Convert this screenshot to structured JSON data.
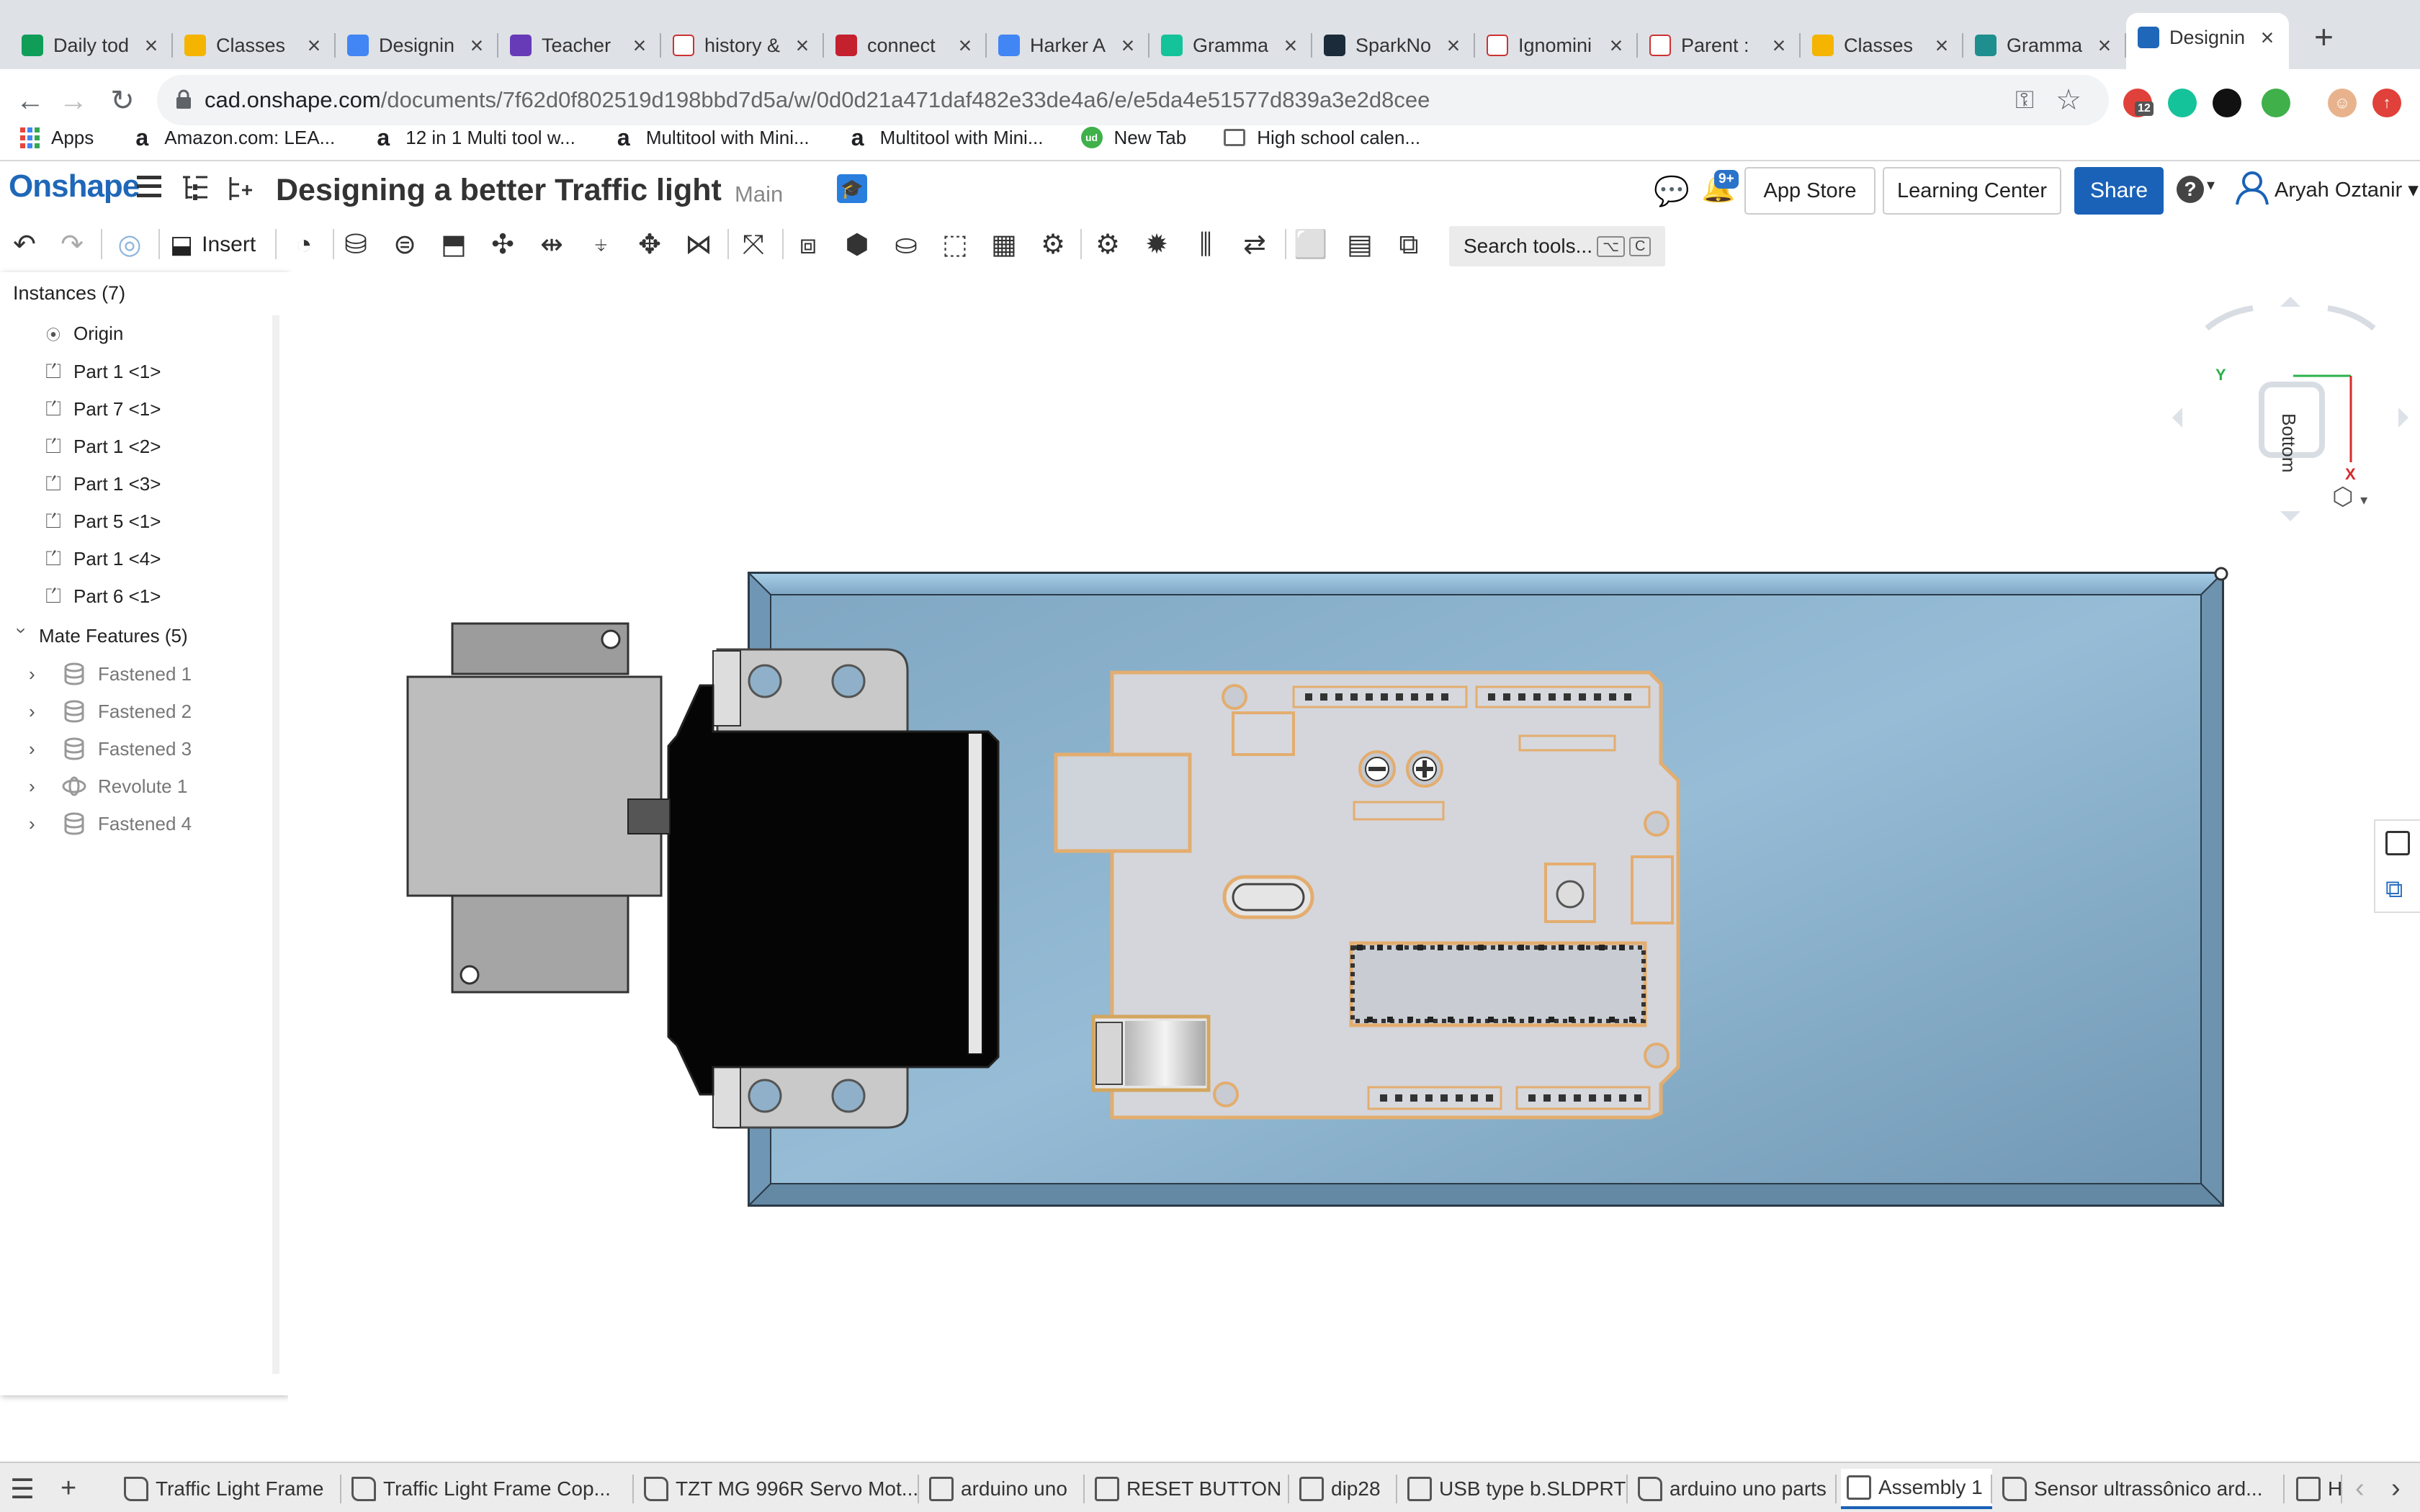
{
  "browser": {
    "tabs": [
      {
        "title": "Daily tod",
        "favicon": "sheets-icon",
        "color": "#0f9d58"
      },
      {
        "title": "Classes",
        "favicon": "classroom-icon",
        "color": "#f4b400"
      },
      {
        "title": "Designin",
        "favicon": "docs-icon",
        "color": "#4285f4"
      },
      {
        "title": "Teacher",
        "favicon": "forms-icon",
        "color": "#673ab7"
      },
      {
        "title": "history &",
        "favicon": "google-icon",
        "color": "#ffffff"
      },
      {
        "title": "connect",
        "favicon": "mcgraw-icon",
        "color": "#c4202e"
      },
      {
        "title": "Harker A",
        "favicon": "docs-icon",
        "color": "#4285f4"
      },
      {
        "title": "Gramma",
        "favicon": "grammarly-icon",
        "color": "#15c39a"
      },
      {
        "title": "SparkNo",
        "favicon": "sparknotes-icon",
        "color": "#1c2b39"
      },
      {
        "title": "Ignomini",
        "favicon": "mw-icon",
        "color": "#ffffff"
      },
      {
        "title": "Parent :",
        "favicon": "parent-icon",
        "color": "#ffffff"
      },
      {
        "title": "Classes",
        "favicon": "classroom-icon",
        "color": "#f4b400"
      },
      {
        "title": "Gramma",
        "favicon": "classroom-icon",
        "color": "#1e8e8e"
      },
      {
        "title": "Designin",
        "favicon": "onshape-icon",
        "color": "#1f67b8"
      }
    ],
    "url_host": "cad.onshape.com",
    "url_path": "/documents/7f62d0f802519d198bbd7d5a/w/0d0d21a471daf482e33de4a6/e/e5da4e51577d839a3e2d8cee",
    "extensions": [
      {
        "name": "ext-red-badge-icon",
        "badge": "12",
        "color": "#e0413a"
      },
      {
        "name": "grammarly-ext-icon",
        "color": "#15c39a"
      },
      {
        "name": "k-ext-icon",
        "color": "#111111"
      },
      {
        "name": "ud-ext-icon",
        "color": "#3fb04a"
      }
    ],
    "bookmarks": [
      "Apps",
      "Amazon.com: LEA...",
      "12 in 1 Multi tool w...",
      "Multitool with Mini...",
      "Multitool with Mini...",
      "New Tab",
      "High school calen..."
    ]
  },
  "onshape": {
    "logo": "Onshape",
    "document_title": "Designing a better Traffic light",
    "branch": "Main",
    "notification_count": "9+",
    "app_store": "App Store",
    "learning_center": "Learning Center",
    "share": "Share",
    "user": "Aryah Oztanir",
    "insert": "Insert",
    "search_tools": "Search tools...",
    "search_kbd": [
      "⌥",
      "C"
    ]
  },
  "panel": {
    "title": "Instances (7)",
    "origin": "Origin",
    "instances": [
      "Part 1 <1>",
      "Part 7 <1>",
      "Part 1 <2>",
      "Part 1 <3>",
      "Part 5 <1>",
      "Part 1 <4>",
      "Part 6 <1>"
    ],
    "mate_title": "Mate Features (5)",
    "mates": [
      {
        "label": "Fastened 1",
        "icon": "fastened-icon"
      },
      {
        "label": "Fastened 2",
        "icon": "fastened-icon"
      },
      {
        "label": "Fastened 3",
        "icon": "fastened-icon"
      },
      {
        "label": "Revolute 1",
        "icon": "revolute-icon"
      },
      {
        "label": "Fastened 4",
        "icon": "fastened-icon"
      }
    ]
  },
  "viewcube": {
    "face": "Bottom",
    "axis_y": "Y",
    "axis_x": "X"
  },
  "bottom_tabs": [
    {
      "label": "Traffic Light Frame",
      "icon": "assembly-tab-icon",
      "active": false
    },
    {
      "label": "Traffic Light Frame Cop...",
      "icon": "assembly-tab-icon",
      "active": false
    },
    {
      "label": "TZT MG 996R Servo Mot...",
      "icon": "assembly-tab-icon",
      "active": false
    },
    {
      "label": "arduino uno",
      "icon": "partstudio-tab-icon",
      "active": false
    },
    {
      "label": "RESET BUTTON",
      "icon": "partstudio-tab-icon",
      "active": false
    },
    {
      "label": "dip28",
      "icon": "partstudio-tab-icon",
      "active": false
    },
    {
      "label": "USB type b.SLDPRT",
      "icon": "partstudio-tab-icon",
      "active": false
    },
    {
      "label": "arduino uno parts",
      "icon": "assembly-tab-icon",
      "active": false
    },
    {
      "label": "Assembly 1",
      "icon": "partstudio-tab-icon",
      "active": true
    },
    {
      "label": "Sensor ultrassônico ard...",
      "icon": "assembly-tab-icon",
      "active": false
    },
    {
      "label": "H",
      "icon": "partstudio-tab-icon",
      "active": false
    }
  ]
}
